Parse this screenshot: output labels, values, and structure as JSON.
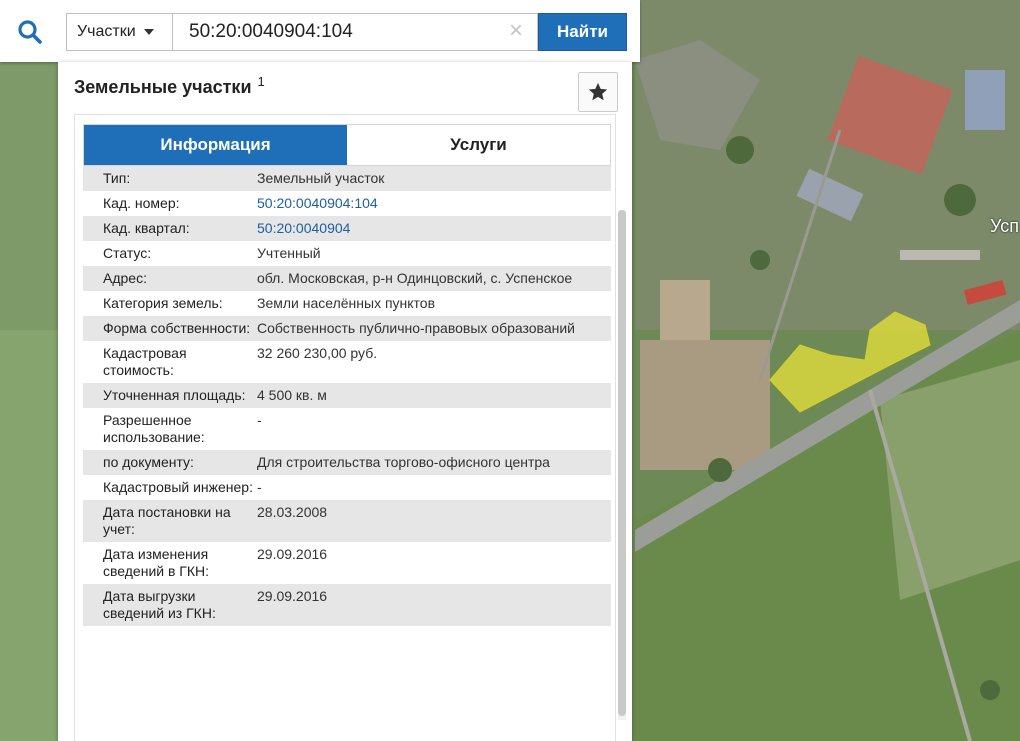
{
  "search": {
    "type_label": "Участки",
    "query": "50:20:0040904:104",
    "find_label": "Найти",
    "clear_glyph": "×"
  },
  "panel": {
    "title": "Земельные участки",
    "title_superscript": "1",
    "tabs": [
      {
        "label": "Информация",
        "active": true
      },
      {
        "label": "Услуги",
        "active": false
      }
    ],
    "rows": [
      {
        "label": "Тип:",
        "value": "Земельный участок",
        "link": false
      },
      {
        "label": "Кад. номер:",
        "value": "50:20:0040904:104",
        "link": true
      },
      {
        "label": "Кад. квартал:",
        "value": "50:20:0040904",
        "link": true
      },
      {
        "label": "Статус:",
        "value": "Учтенный",
        "link": false
      },
      {
        "label": "Адрес:",
        "value": "обл. Московская, р-н Одинцовский, с. Успенское",
        "link": false
      },
      {
        "label": "Категория земель:",
        "value": "Земли населённых пунктов",
        "link": false
      },
      {
        "label": "Форма собственности:",
        "value": "Собственность публично-правовых образований",
        "link": false
      },
      {
        "label": "Кадастровая стоимость:",
        "value": "32 260 230,00 руб.",
        "link": false
      },
      {
        "label": "Уточненная площадь:",
        "value": "4 500 кв. м",
        "link": false
      },
      {
        "label": "Разрешенное использование:",
        "value": "-",
        "link": false
      },
      {
        "label": "по документу:",
        "value": "Для строительства торгово-офисного центра",
        "link": false
      },
      {
        "label": "Кадастровый инженер:",
        "value": "-",
        "link": false
      },
      {
        "label": "Дата постановки на учет:",
        "value": "28.03.2008",
        "link": false
      },
      {
        "label": "Дата изменения сведений в ГКН:",
        "value": "29.09.2016",
        "link": false
      },
      {
        "label": "Дата выгрузки сведений из ГКН:",
        "value": "29.09.2016",
        "link": false
      }
    ]
  },
  "map": {
    "label_partial": "Усп"
  },
  "icons": {
    "search": "search-icon",
    "star": "star-icon",
    "caret": "chevron-down-icon",
    "clear": "close-icon"
  },
  "colors": {
    "accent": "#1f6fb8",
    "parcel_highlight": "#e8e23a",
    "link": "#1e5fa0"
  }
}
